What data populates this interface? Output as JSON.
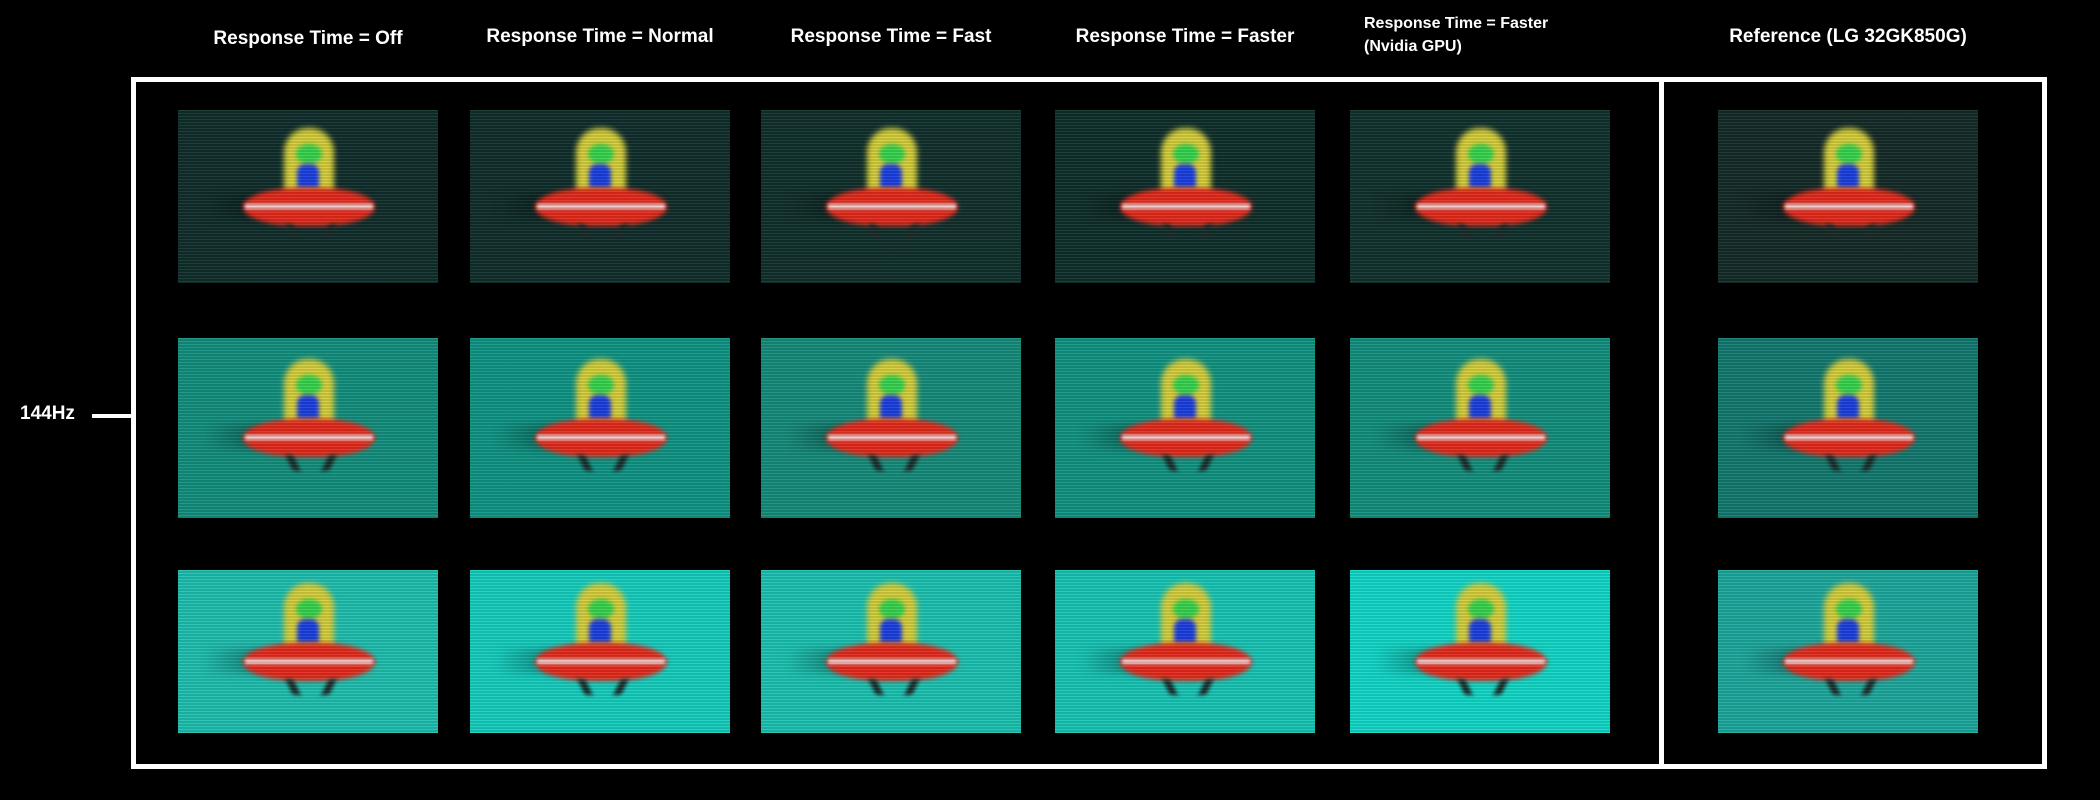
{
  "columns": [
    {
      "title": "Response Time = Off"
    },
    {
      "title": "Response Time = Normal"
    },
    {
      "title": "Response Time = Fast"
    },
    {
      "title": "Response Time = Faster"
    },
    {
      "title_line1": "Response Time = Faster",
      "title_line2": "(Nvidia GPU)"
    },
    {
      "title": "Reference (LG 32GK850G)"
    }
  ],
  "row_label": "144Hz",
  "rows": [
    {
      "name": "dark-background",
      "colors": [
        "#0f2e2b",
        "#0f2e2b",
        "#10302c",
        "#0f2f2b",
        "#10312d",
        "#142a27"
      ]
    },
    {
      "name": "mid-background",
      "colors": [
        "#13907f",
        "#0f9585",
        "#168c7c",
        "#119483",
        "#13907f",
        "#137a70"
      ]
    },
    {
      "name": "bright-background",
      "colors": [
        "#1fbfb0",
        "#15cfc0",
        "#1cc3b2",
        "#17c6b6",
        "#12d8c8",
        "#1ea99e"
      ]
    }
  ],
  "image_description": "Pursuit camera UFO test captures showing motion blur/overdrive artifacts"
}
